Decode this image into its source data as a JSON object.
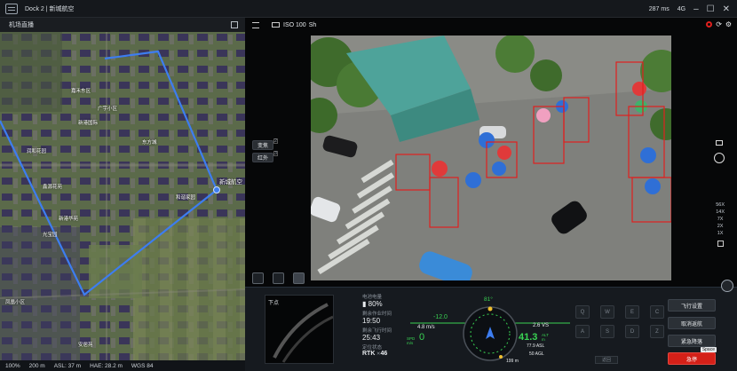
{
  "topbar": {
    "title": "Dock 2 | 新城航空",
    "speed": "287 ms",
    "signal_badge": "4G",
    "minimize": "–",
    "maximize": "☐",
    "close": "✕"
  },
  "map": {
    "header": "机场直播",
    "labels": [
      {
        "text": "新城航空"
      },
      {
        "text": "嘉禾东区"
      },
      {
        "text": "新港国际"
      },
      {
        "text": "鑫源花苑"
      },
      {
        "text": "新港华苑"
      },
      {
        "text": "光宝园"
      },
      {
        "text": "和谐家园"
      },
      {
        "text": "凤凰小区"
      },
      {
        "text": "安居苑"
      },
      {
        "text": "广宇小区"
      },
      {
        "text": "润和花园"
      },
      {
        "text": "东方城"
      }
    ],
    "footer": {
      "zoom": "100%",
      "scale": "200 m",
      "asl": "ASL: 37 m",
      "hae": "HAE: 28.2 m",
      "crs": "WGS 84"
    }
  },
  "video": {
    "lens": "ISO 100",
    "lens_suffix": "Sh",
    "mode_buttons": [
      {
        "label": "变焦",
        "badge": "2"
      },
      {
        "label": "红外",
        "badge": "3"
      }
    ],
    "zoom_levels": [
      "56X",
      "14X",
      "7X",
      "2X",
      "1X"
    ]
  },
  "telemetry": {
    "fpv_label": "下点",
    "battery_label": "电池电量",
    "battery": "80%",
    "flight_time_label": "剩余作业时间",
    "flight_time": "19:50",
    "remaining_label": "剩余飞行时间",
    "remaining": "25:43",
    "position_label": "定位状态",
    "rtk": "RTK",
    "rtk_sats": "46",
    "heading": "81°",
    "h_speed": "4.8 m/s",
    "v_speed_neg": "-12.0",
    "spd_label": "SPD m/s",
    "spd": "0",
    "vs": "2.6 VS",
    "alt_label": "ALT m",
    "alt": "41.3",
    "asl": "77.9 ASL",
    "agl": "50 AGL",
    "home_dist": "199 m",
    "keys": [
      "Q",
      "W",
      "E",
      "C",
      "A",
      "S",
      "D",
      "Z"
    ],
    "return_btn": "返回",
    "actions": [
      {
        "label": "飞行设置"
      },
      {
        "label": "取消返航"
      },
      {
        "label": "紧急降落"
      },
      {
        "label": "急停",
        "hint": "Space"
      }
    ]
  },
  "colors": {
    "accent_green": "#39d353",
    "alert_red": "#d42018",
    "flight_path": "#3d7df0",
    "detection_box": "#e0201e"
  }
}
